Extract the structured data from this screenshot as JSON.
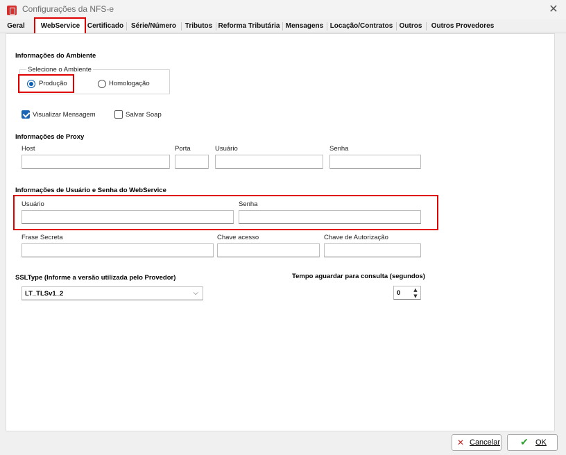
{
  "window": {
    "title": "Configurações da NFS-e"
  },
  "tabs": [
    {
      "label": "Geral"
    },
    {
      "label": "WebService"
    },
    {
      "label": "Certificado"
    },
    {
      "label": "Série/Número"
    },
    {
      "label": "Tributos"
    },
    {
      "label": "Reforma Tributária"
    },
    {
      "label": "Mensagens"
    },
    {
      "label": "Locação/Contratos"
    },
    {
      "label": "Outros"
    },
    {
      "label": "Outros Provedores"
    }
  ],
  "active_tab": "WebService",
  "ambiente": {
    "section_title": "Informações do Ambiente",
    "group_label": "Selecione o Ambiente",
    "options": [
      {
        "label": "Produção",
        "selected": true
      },
      {
        "label": "Homologação",
        "selected": false
      }
    ]
  },
  "options": {
    "visualizar_mensagem": {
      "label": "Visualizar Mensagem",
      "checked": true
    },
    "salvar_soap": {
      "label": "Salvar Soap",
      "checked": false
    }
  },
  "proxy": {
    "section_title": "Informações de Proxy",
    "host_label": "Host",
    "host_value": "",
    "porta_label": "Porta",
    "porta_value": "",
    "usuario_label": "Usuário",
    "usuario_value": "",
    "senha_label": "Senha",
    "senha_value": ""
  },
  "ws_auth": {
    "section_title": "Informações de Usuário e Senha do WebService",
    "usuario_label": "Usuário",
    "usuario_value": "",
    "senha_label": "Senha",
    "senha_value": "",
    "frase_label": "Frase Secreta",
    "frase_value": "",
    "chave_acesso_label": "Chave acesso",
    "chave_acesso_value": "",
    "chave_autorizacao_label": "Chave de Autorização",
    "chave_autorizacao_value": ""
  },
  "ssl": {
    "label": "SSLType (Informe a versão utilizada pelo Provedor)",
    "value": "LT_TLSv1_2"
  },
  "timeout": {
    "label": "Tempo aguardar para consulta (segundos)",
    "value": "0"
  },
  "buttons": {
    "cancel": "Cancelar",
    "ok": "OK"
  },
  "colors": {
    "highlight": "#e00000",
    "accent": "#0a5fb4",
    "ok_check": "#2e9e2e",
    "cancel_x": "#c62828"
  }
}
